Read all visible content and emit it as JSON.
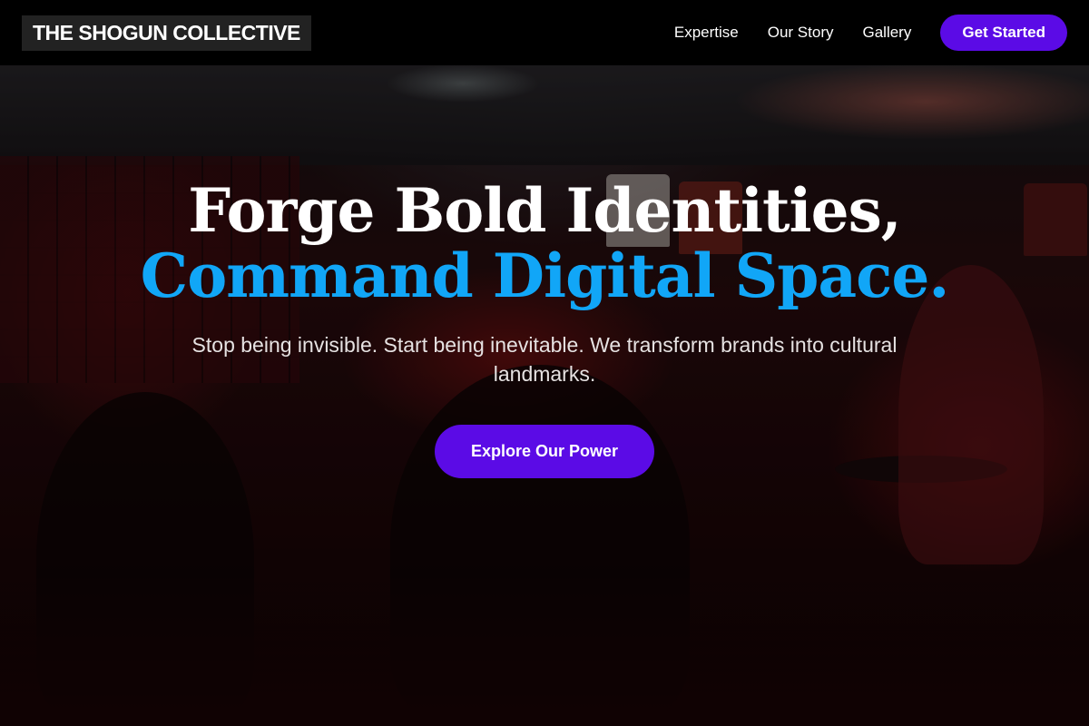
{
  "brand": {
    "name": "THE SHOGUN COLLECTIVE"
  },
  "nav": {
    "links": [
      {
        "label": "Expertise"
      },
      {
        "label": "Our Story"
      },
      {
        "label": "Gallery"
      }
    ],
    "cta_label": "Get Started"
  },
  "hero": {
    "headline_line1": "Forge Bold Identities,",
    "headline_line2": "Command Digital Space.",
    "subtitle": "Stop being invisible. Start being inevitable. We transform brands into cultural landmarks.",
    "button_label": "Explore Our Power"
  },
  "colors": {
    "accent_purple": "#5b0be6",
    "headline_blue": "#11a6f7",
    "nav_background": "#000000"
  }
}
